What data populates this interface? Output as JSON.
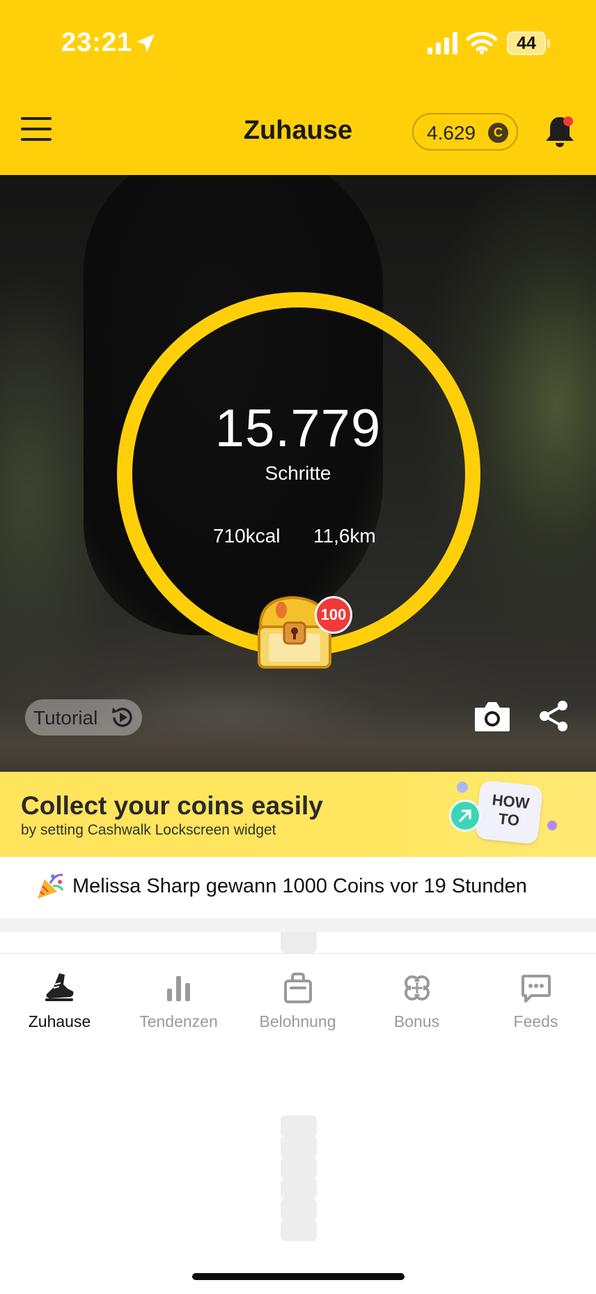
{
  "status_bar": {
    "time": "23:21",
    "battery": "44"
  },
  "header": {
    "title": "Zuhause",
    "coins": "4.629",
    "coin_symbol": "C"
  },
  "hero": {
    "steps": "15.779",
    "steps_label": "Schritte",
    "kcal": "710kcal",
    "distance": "11,6km",
    "chest_badge": "100",
    "tutorial_label": "Tutorial"
  },
  "banner": {
    "title": "Collect your coins easily",
    "subtitle": "by setting Cashwalk Lockscreen widget",
    "howto": "HOW TO"
  },
  "ticker": {
    "text": "Melissa Sharp gewann 1000 Coins vor 19 Stunden"
  },
  "tabs": [
    {
      "label": "Zuhause",
      "icon": "shoe-icon",
      "active": true
    },
    {
      "label": "Tendenzen",
      "icon": "bar-chart-icon",
      "active": false
    },
    {
      "label": "Belohnung",
      "icon": "shopping-bag-icon",
      "active": false
    },
    {
      "label": "Bonus",
      "icon": "clover-icon",
      "active": false
    },
    {
      "label": "Feeds",
      "icon": "chat-icon",
      "active": false
    }
  ],
  "colors": {
    "brand_yellow": "#FFD00A",
    "badge_red": "#F03A3A",
    "inactive_tab": "#9a9a9a"
  }
}
